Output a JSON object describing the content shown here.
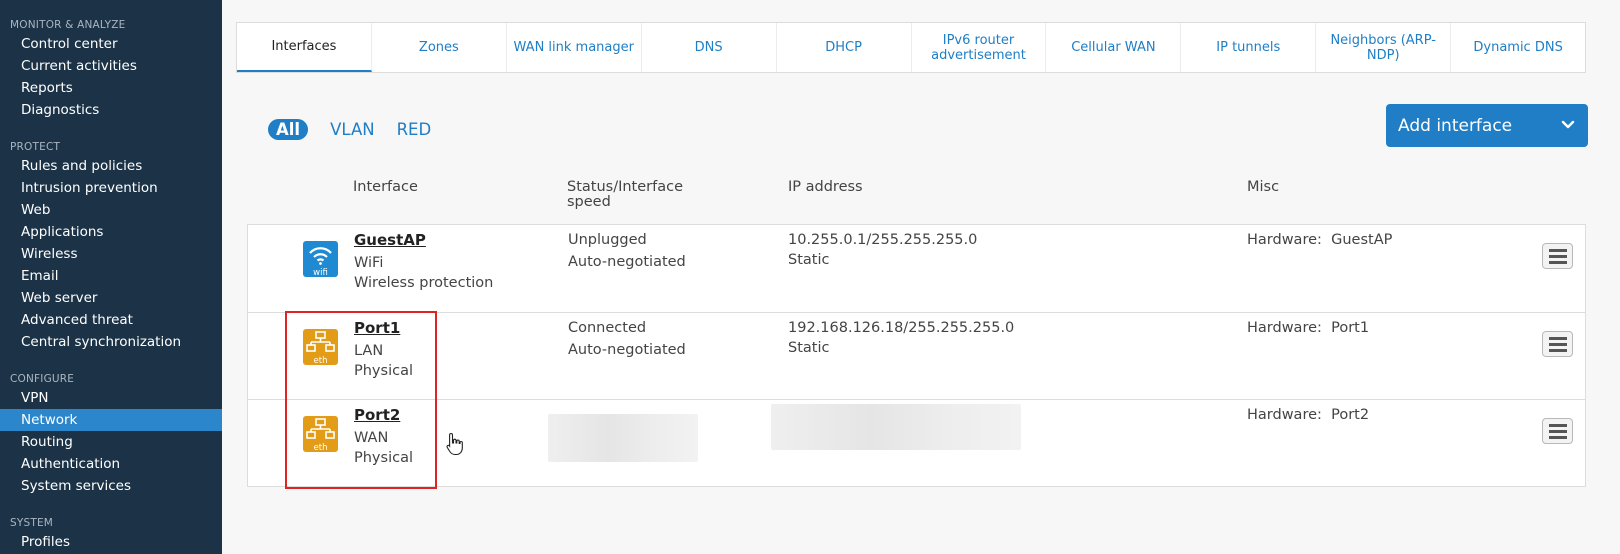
{
  "sidebar": {
    "sections": [
      {
        "title": "MONITOR & ANALYZE",
        "items": [
          "Control center",
          "Current activities",
          "Reports",
          "Diagnostics"
        ]
      },
      {
        "title": "PROTECT",
        "items": [
          "Rules and policies",
          "Intrusion prevention",
          "Web",
          "Applications",
          "Wireless",
          "Email",
          "Web server",
          "Advanced threat",
          "Central synchronization"
        ]
      },
      {
        "title": "CONFIGURE",
        "items": [
          "VPN",
          "Network",
          "Routing",
          "Authentication",
          "System services"
        ]
      },
      {
        "title": "SYSTEM",
        "items": [
          "Profiles"
        ]
      }
    ],
    "active_item": "Network"
  },
  "tabs": [
    "Interfaces",
    "Zones",
    "WAN link manager",
    "DNS",
    "DHCP",
    "IPv6 router advertisement",
    "Cellular WAN",
    "IP tunnels",
    "Neighbors (ARP-NDP)",
    "Dynamic DNS"
  ],
  "filters": [
    "All",
    "VLAN",
    "RED"
  ],
  "add_button_label": "Add interface",
  "columns": {
    "interface": "Interface",
    "status": "Status/Interface speed",
    "ip": "IP address",
    "misc": "Misc"
  },
  "rows": [
    {
      "name": "GuestAP",
      "icon": "wifi-icon",
      "icon_label": "wifi",
      "type": "WiFi",
      "subtype": "Wireless protection",
      "status": "Unplugged",
      "speed": "Auto-negotiated",
      "ip": "10.255.0.1/255.255.255.0",
      "ip_mode": "Static",
      "hardware_label": "Hardware:",
      "hardware": "GuestAP"
    },
    {
      "name": "Port1",
      "icon": "ethernet-icon",
      "icon_label": "eth",
      "type": "LAN",
      "subtype": "Physical",
      "status": "Connected",
      "speed": "Auto-negotiated",
      "ip": "192.168.126.18/255.255.255.0",
      "ip_mode": "Static",
      "hardware_label": "Hardware:",
      "hardware": "Port1"
    },
    {
      "name": "Port2",
      "icon": "ethernet-icon",
      "icon_label": "eth",
      "type": "WAN",
      "subtype": "Physical",
      "status": "",
      "speed": "",
      "ip": "",
      "ip_mode": "",
      "hardware_label": "Hardware:",
      "hardware": "Port2"
    }
  ],
  "colors": {
    "sidebar_bg": "#1c3347",
    "accent": "#1f7ec5",
    "wifi_icon": "#1f8ad1",
    "eth_icon": "#e29c18",
    "highlight": "#e02424"
  }
}
